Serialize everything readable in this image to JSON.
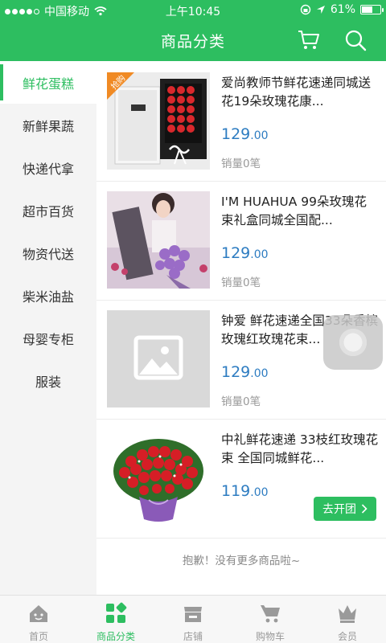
{
  "status_bar": {
    "carrier": "中国移动",
    "time": "上午10:45",
    "battery_text": "61%",
    "battery_level": 0.61
  },
  "header": {
    "title": "商品分类",
    "cart_icon": "cart-icon",
    "search_icon": "search-icon"
  },
  "sidebar": {
    "items": [
      {
        "label": "鲜花蛋糕",
        "active": true
      },
      {
        "label": "新鲜果蔬",
        "active": false
      },
      {
        "label": "快递代拿",
        "active": false
      },
      {
        "label": "超市百货",
        "active": false
      },
      {
        "label": "物资代送",
        "active": false
      },
      {
        "label": "柴米油盐",
        "active": false
      },
      {
        "label": "母婴专柜",
        "active": false
      },
      {
        "label": "服装",
        "active": false
      }
    ]
  },
  "products": [
    {
      "title": "爱尚教师节鲜花速递同城送花19朵玫瑰花康...",
      "price_int": "129",
      "price_dec": ".00",
      "sales": "销量0笔",
      "badge": "抢购"
    },
    {
      "title": "I'M HUAHUA 99朵玫瑰花束礼盒同城全国配...",
      "price_int": "129",
      "price_dec": ".00",
      "sales": "销量0笔"
    },
    {
      "title": "钟爱 鲜花速递全国33朵香槟玫瑰红玫瑰花束...",
      "price_int": "129",
      "price_dec": ".00",
      "sales": "销量0笔"
    },
    {
      "title": "中礼鲜花速递 33枝红玫瑰花束 全国同城鲜花...",
      "price_int": "119",
      "price_dec": ".00",
      "button": "去开团"
    }
  ],
  "no_more": "抱歉！没有更多商品啦~",
  "tabs": [
    {
      "label": "首页",
      "icon": "home-icon",
      "active": false
    },
    {
      "label": "商品分类",
      "icon": "category-icon",
      "active": true
    },
    {
      "label": "店铺",
      "icon": "shop-icon",
      "active": false
    },
    {
      "label": "购物车",
      "icon": "cart-icon",
      "active": false
    },
    {
      "label": "会员",
      "icon": "crown-icon",
      "active": false
    }
  ],
  "colors": {
    "primary": "#2dbe60",
    "price": "#2d7cc1"
  }
}
